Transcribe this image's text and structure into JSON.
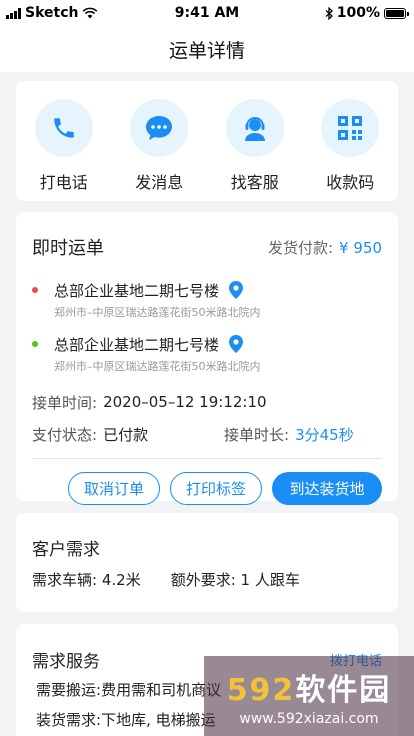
{
  "status_bar": {
    "carrier": "Sketch",
    "time": "9:41 AM",
    "battery": "100%"
  },
  "nav": {
    "title": "运单详情"
  },
  "actions": [
    {
      "label": "打电话",
      "icon": "phone-icon"
    },
    {
      "label": "发消息",
      "icon": "chat-icon"
    },
    {
      "label": "找客服",
      "icon": "support-icon"
    },
    {
      "label": "收款码",
      "icon": "qrcode-icon"
    }
  ],
  "order": {
    "title": "即时运单",
    "pay_label": "发货付款:",
    "pay_amount": "¥ 950",
    "from": {
      "name": "总部企业基地二期七号楼",
      "detail": "郑州市–中原区瑞达路莲花街50米路北院内",
      "dot_color": "#f04848"
    },
    "to": {
      "name": "总部企业基地二期七号楼",
      "detail": "郑州市–中原区瑞达路莲花街50米路北院内",
      "dot_color": "#52c41a"
    },
    "accept_time_label": "接单时间:",
    "accept_time": "2020–05–12   19:12:10",
    "pay_status_label": "支付状态:",
    "pay_status": "已付款",
    "duration_label": "接单时长:",
    "duration": "3分45秒",
    "buttons": {
      "cancel": "取消订单",
      "print": "打印标签",
      "arrive": "到达装货地"
    }
  },
  "demand": {
    "title": "客户需求",
    "vehicle_label": "需求车辆:",
    "vehicle": "4.2米",
    "extra_label": "额外要求:",
    "extra": "1 人跟车"
  },
  "service": {
    "title": "需求服务",
    "link": "拨打电话",
    "carry_label": "需要搬运:",
    "carry": "费用需和司机商议",
    "load_label": "装货需求:",
    "load": "下地库, 电梯搬运"
  },
  "watermark": {
    "logo_num": "592",
    "logo_text": "软件园",
    "url": "www.592xiazai.com"
  },
  "colors": {
    "accent": "#1a8ef5",
    "bg": "#f2f3f5"
  }
}
